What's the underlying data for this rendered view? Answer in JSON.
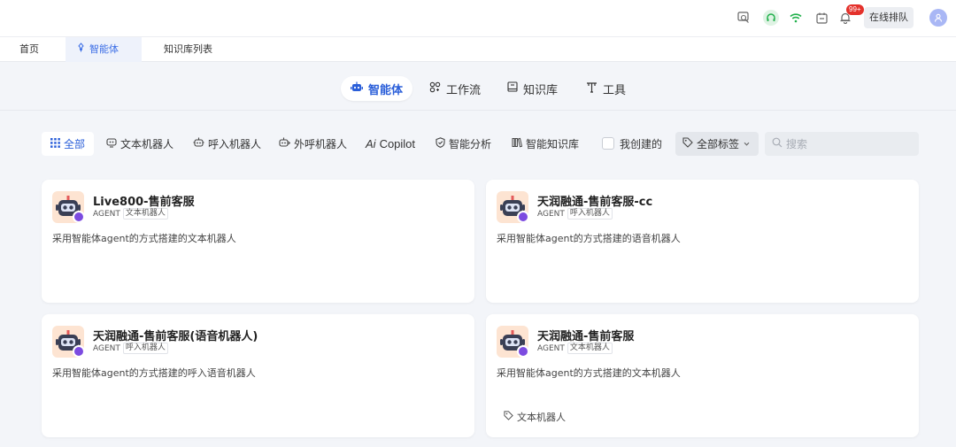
{
  "topbar": {
    "notification_count": "99+",
    "queue_button": "在线排队",
    "icons": [
      "chat-search-icon",
      "headset-icon",
      "wifi-icon",
      "calendar-icon",
      "bell-icon",
      "user-icon"
    ]
  },
  "page_tabs": [
    {
      "label": "首页"
    },
    {
      "label": "智能体",
      "icon": "pin-icon",
      "active": true
    },
    {
      "label": "知识库列表"
    }
  ],
  "segments": [
    {
      "label": "智能体",
      "icon": "robot-icon",
      "active": true
    },
    {
      "label": "工作流",
      "icon": "workflow-icon"
    },
    {
      "label": "知识库",
      "icon": "book-icon"
    },
    {
      "label": "工具",
      "icon": "tool-icon"
    }
  ],
  "filters": [
    {
      "label": "全部",
      "icon": "grid-icon",
      "active": true
    },
    {
      "label": "文本机器人",
      "icon": "chat-bot-icon"
    },
    {
      "label": "呼入机器人",
      "icon": "inbound-bot-icon"
    },
    {
      "label": "外呼机器人",
      "icon": "outbound-bot-icon"
    },
    {
      "label": "Copilot",
      "icon": "ai-icon"
    },
    {
      "label": "智能分析",
      "icon": "shield-icon"
    },
    {
      "label": "智能知识库",
      "icon": "library-icon"
    }
  ],
  "mine_label": "我创建的",
  "tag_select": "全部标签",
  "search_placeholder": "搜索",
  "cards": [
    {
      "title": "Live800-售前客服",
      "type": "AGENT",
      "category": "文本机器人",
      "description": "采用智能体agent的方式搭建的文本机器人",
      "tag": ""
    },
    {
      "title": "天润融通-售前客服-cc",
      "type": "AGENT",
      "category": "呼入机器人",
      "description": "采用智能体agent的方式搭建的语音机器人",
      "tag": ""
    },
    {
      "title": "天润融通-售前客服(语音机器人)",
      "type": "AGENT",
      "category": "呼入机器人",
      "description": "采用智能体agent的方式搭建的呼入语音机器人",
      "tag": ""
    },
    {
      "title": "天润融通-售前客服",
      "type": "AGENT",
      "category": "文本机器人",
      "description": "采用智能体agent的方式搭建的文本机器人",
      "tag": "文本机器人"
    }
  ],
  "colors": {
    "accent": "#2b5fd9",
    "badge": "#e4312b",
    "headset": "#22b14c",
    "wifi": "#22b14c",
    "robot_badge": "#7c4be0"
  }
}
